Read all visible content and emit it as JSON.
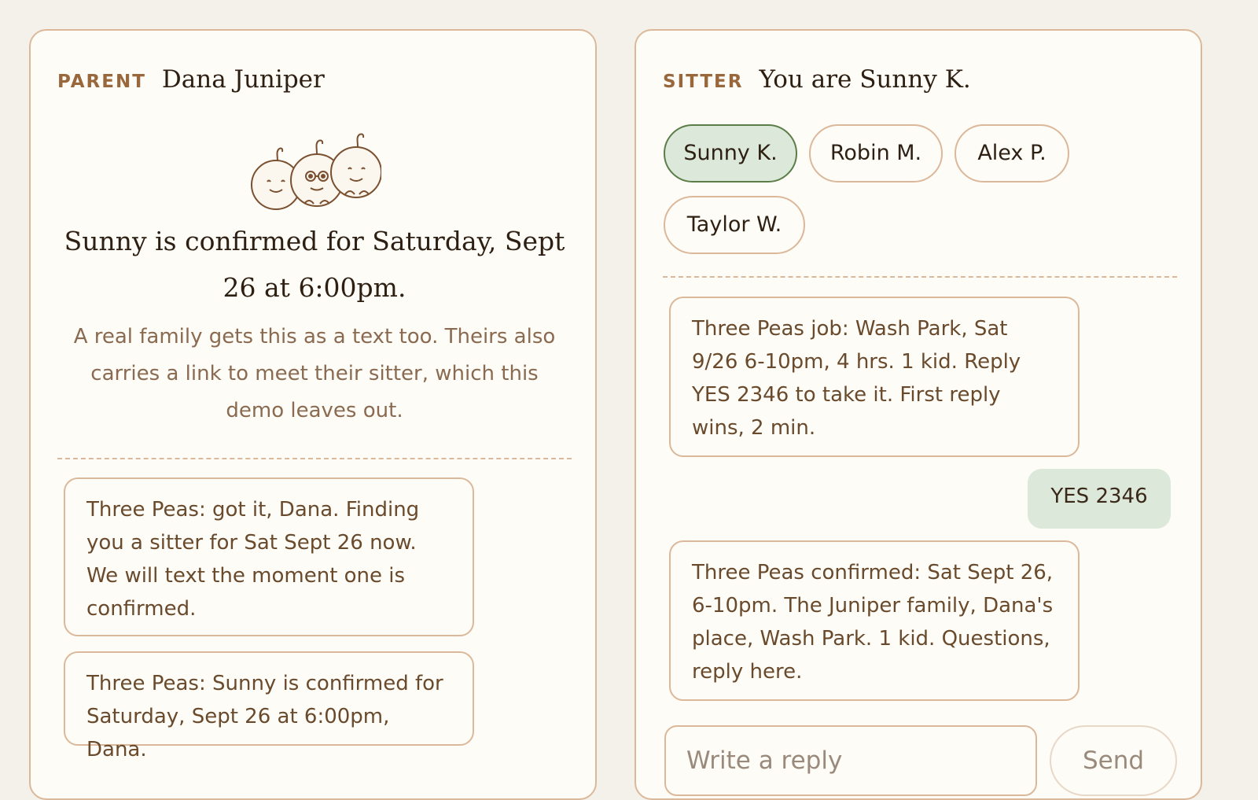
{
  "parent_panel": {
    "role_label": "PARENT",
    "name": "Dana Juniper",
    "illustration_icon": "three-peas-icon",
    "confirmation_heading": "Sunny is confirmed for Saturday, Sept 26 at 6:00pm.",
    "confirmation_note": "A real family gets this as a text too. Theirs also carries a link to meet their sitter, which this demo leaves out.",
    "messages": [
      "Three Peas: got it, Dana. Finding you a sitter for Sat Sept 26 now. We will text the moment one is confirmed.",
      "Three Peas: Sunny is confirmed for Saturday, Sept 26 at 6:00pm, Dana."
    ]
  },
  "sitter_panel": {
    "role_label": "SITTER",
    "identity": "You are Sunny K.",
    "sitters": [
      "Sunny K.",
      "Robin M.",
      "Alex P.",
      "Taylor W."
    ],
    "selected_sitter": "Sunny K.",
    "messages": [
      "Three Peas job: Wash Park, Sat 9/26 6-10pm, 4 hrs. 1 kid. Reply YES 2346 to take it. First reply wins, 2 min.",
      "YES 2346",
      "Three Peas confirmed: Sat Sept 26, 6-10pm. The Juniper family, Dana's place, Wash Park. 1 kid. Questions, reply here."
    ],
    "reply_placeholder": "Write a reply",
    "send_label": "Send"
  },
  "colors": {
    "background": "#f4f0ea",
    "card": "#fdfcf7",
    "border": "#dcb89a",
    "accent_label": "#99673c",
    "sent_bubble": "#dce8d9",
    "selected_chip_border": "#5b7d48"
  }
}
